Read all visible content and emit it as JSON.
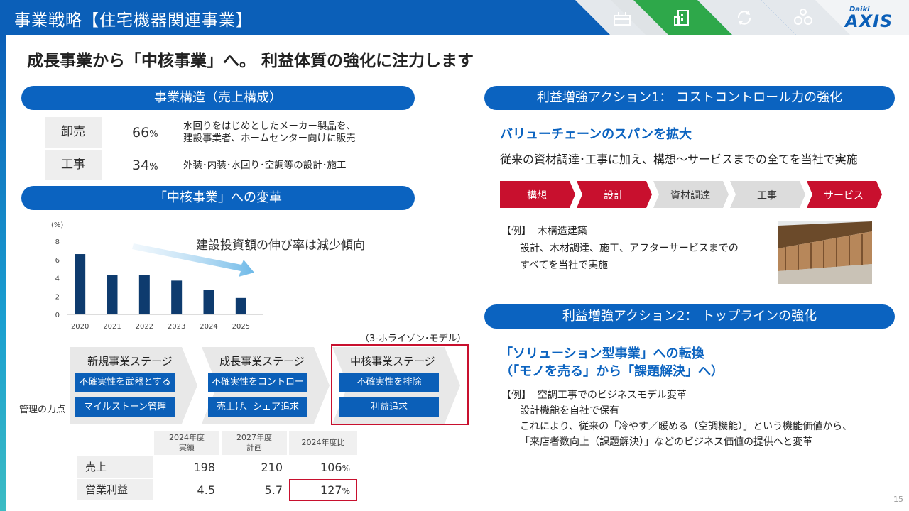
{
  "header": {
    "title": "事業戦略【住宅機器関連事業】",
    "logo_small": "Daiki",
    "logo_big": "AXIS",
    "nav_icons": [
      "house-icon",
      "building-icon",
      "cycle-icon",
      "people-icon"
    ]
  },
  "headline": "成長事業から「中核事業」へ。 利益体質の強化に注力します",
  "structure": {
    "title": "事業構造（売上構成）",
    "rows": [
      {
        "label": "卸売",
        "pct": "66",
        "unit": "%",
        "desc1": "水回りをはじめとしたメーカー製品を、",
        "desc2": "建設事業者、ホームセンター向けに販売"
      },
      {
        "label": "工事",
        "pct": "34",
        "unit": "%",
        "desc1": "外装･内装･水回り･空調等の設計･施工",
        "desc2": ""
      }
    ]
  },
  "transform": {
    "title": "「中核事業」への変革",
    "note": "建設投資額の伸び率は減少傾向"
  },
  "chart_data": {
    "type": "bar",
    "categories": [
      "2020",
      "2021",
      "2022",
      "2023",
      "2024",
      "2025"
    ],
    "values": [
      6.6,
      4.3,
      4.3,
      3.7,
      2.7,
      1.8
    ],
    "ylabel": "(%)",
    "yticks": [
      "0",
      "2",
      "4",
      "6",
      "8"
    ],
    "ylim": [
      0,
      8
    ],
    "color": "#0e3b6e"
  },
  "stages": {
    "horizon_label": "（3-ホライゾン･モデル）",
    "row_label": "管理の力点",
    "items": [
      {
        "title": "新規事業ステージ",
        "b1": "不確実性を武器とする",
        "b2": "マイルストーン管理"
      },
      {
        "title": "成長事業ステージ",
        "b1": "不確実性をコントロール",
        "b2": "売上げ、シェア追求"
      },
      {
        "title": "中核事業ステージ",
        "b1": "不確実性を排除",
        "b2": "利益追求"
      }
    ]
  },
  "results": {
    "col1a": "2024年度",
    "col1b": "実績",
    "col2a": "2027年度",
    "col2b": "計画",
    "col3": "2024年度比",
    "rows": [
      {
        "label": "売上",
        "v1": "198",
        "v2": "210",
        "v3": "106",
        "unit": "%"
      },
      {
        "label": "営業利益",
        "v1": "4.5",
        "v2": "5.7",
        "v3": "127",
        "unit": "%"
      }
    ]
  },
  "action1": {
    "title": "利益増強アクション1：  コストコントロール力の強化",
    "subtitle": "バリューチェーンのスパンを拡大",
    "text": "従来の資材調達･工事に加え、構想～サービスまでの全てを当社で実施",
    "chain": [
      "構想",
      "設計",
      "資材調達",
      "工事",
      "サービス"
    ],
    "ex_tag": "【例】",
    "ex_title": "木構造建築",
    "ex_line1": "設計、木材調達、施工、アフターサービスまでの",
    "ex_line2": "すべてを当社で実施"
  },
  "action2": {
    "title": "利益増強アクション2：  トップラインの強化",
    "subtitle1": "「ソリューション型事業」への転換",
    "subtitle2": "（「モノを売る」から「課題解決」へ）",
    "ex_tag": "【例】",
    "ex_title": "空調工事でのビジネスモデル変革",
    "line1": "設計機能を自社で保有",
    "line2": "これにより、従来の「冷やす／暖める（空調機能）」という機能価値から、",
    "line3": "「来店者数向上（課題解決）」などのビジネス価値の提供へと変革"
  },
  "page": "15"
}
